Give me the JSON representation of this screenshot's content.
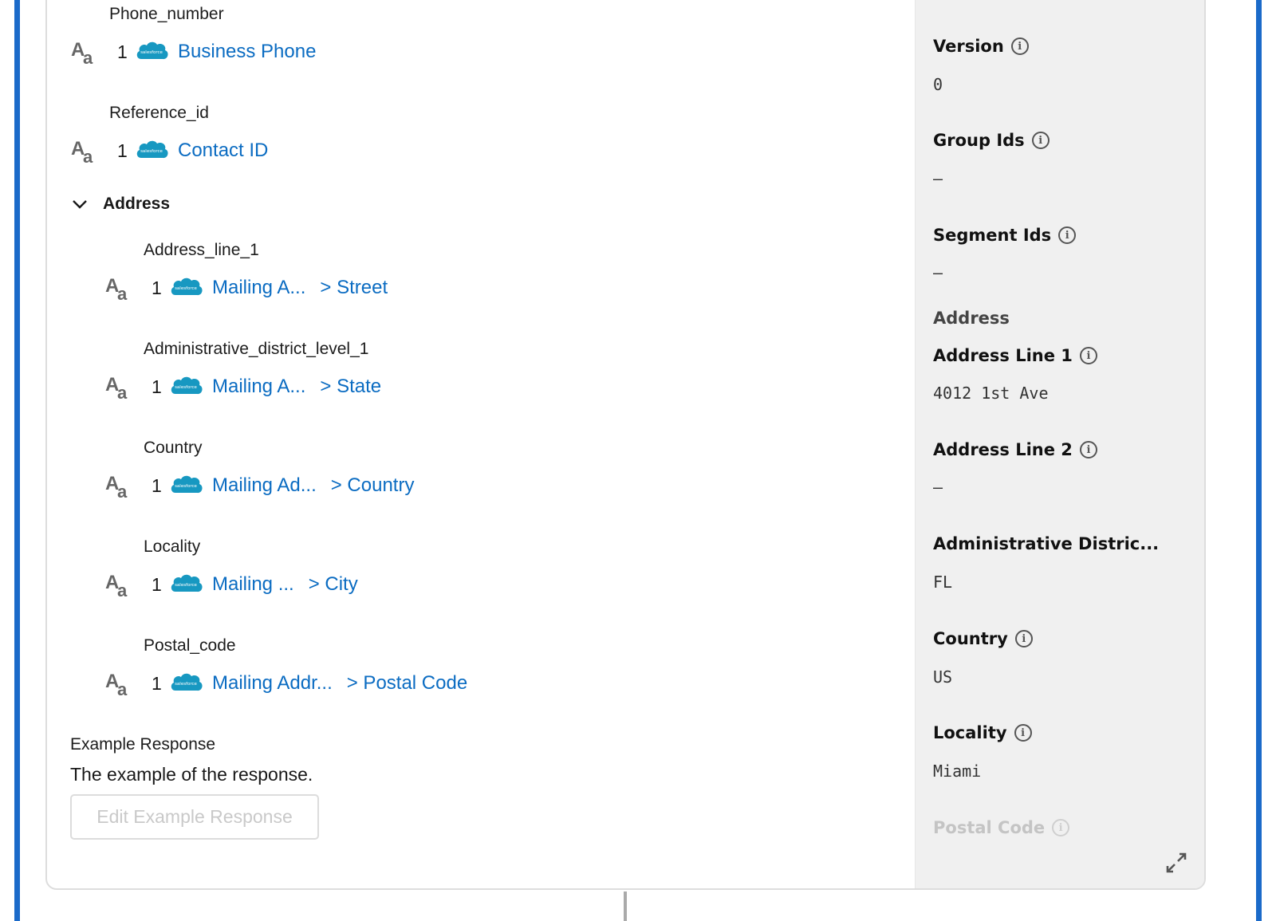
{
  "mappings_top": [
    {
      "field": "Phone_number",
      "type_icon": "text-type-icon",
      "count": "1",
      "source": "Business Phone",
      "sub": ""
    },
    {
      "field": "Reference_id",
      "type_icon": "text-type-icon",
      "count": "1",
      "source": "Contact ID",
      "sub": ""
    }
  ],
  "address_section": {
    "title": "Address",
    "expanded": true,
    "mappings": [
      {
        "field": "Address_line_1",
        "count": "1",
        "source": "Mailing A...",
        "sub": "> Street"
      },
      {
        "field": "Administrative_district_level_1",
        "count": "1",
        "source": "Mailing A...",
        "sub": "> State"
      },
      {
        "field": "Country",
        "count": "1",
        "source": "Mailing Ad...",
        "sub": "> Country"
      },
      {
        "field": "Locality",
        "count": "1",
        "source": "Mailing ...",
        "sub": "> City"
      },
      {
        "field": "Postal_code",
        "count": "1",
        "source": "Mailing Addr...",
        "sub": "> Postal Code"
      }
    ]
  },
  "type_icon_text": {
    "upper": "A",
    "lower": "a"
  },
  "source_logo_text": "salesforce",
  "example_response": {
    "label": "Example Response",
    "text": "The example of the response.",
    "button_label": "Edit Example Response"
  },
  "details_panel": {
    "version": {
      "label": "Version",
      "value": "0"
    },
    "group_ids": {
      "label": "Group Ids",
      "value": "–"
    },
    "segment_ids": {
      "label": "Segment Ids",
      "value": "–"
    },
    "address_group": "Address",
    "address_line_1": {
      "label": "Address Line 1",
      "value": "4012 1st Ave"
    },
    "address_line_2": {
      "label": "Address Line 2",
      "value": "–"
    },
    "administrative_district": {
      "label": "Administrative Distric...",
      "value": "FL"
    },
    "country": {
      "label": "Country",
      "value": "US"
    },
    "locality": {
      "label": "Locality",
      "value": "Miami"
    },
    "postal_code": {
      "label": "Postal Code"
    },
    "info_glyph": "i"
  },
  "colors": {
    "accent": "#1b6ac9",
    "link": "#0b6cc2",
    "salesforce": "#1798c1",
    "panel": "#f0f0f0"
  }
}
